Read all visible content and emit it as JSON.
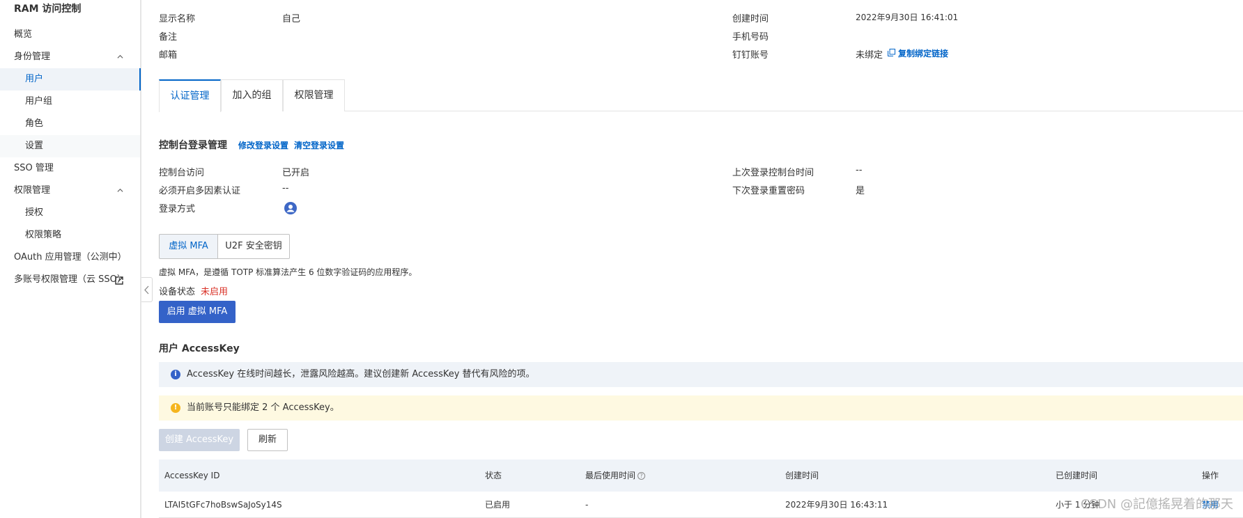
{
  "sidebar": {
    "title": "RAM 访问控制",
    "items": [
      {
        "label": "概览"
      },
      {
        "label": "身份管理"
      },
      {
        "label": "用户"
      },
      {
        "label": "用户组"
      },
      {
        "label": "角色"
      },
      {
        "label": "设置"
      },
      {
        "label": "SSO 管理"
      },
      {
        "label": "权限管理"
      },
      {
        "label": "授权"
      },
      {
        "label": "权限策略"
      },
      {
        "label": "OAuth 应用管理（公测中）"
      },
      {
        "label": "多账号权限管理（云 SSO）"
      }
    ]
  },
  "basic_info": {
    "display_name_label": "显示名称",
    "display_name_value": "自己",
    "remark_label": "备注",
    "email_label": "邮箱",
    "created_label": "创建时间",
    "created_value": "2022年9月30日 16:41:01",
    "phone_label": "手机号码",
    "dingtalk_label": "钉钉账号",
    "dingtalk_value": "未绑定",
    "copy_bind_link": "复制绑定链接"
  },
  "tabs": [
    {
      "label": "认证管理"
    },
    {
      "label": "加入的组"
    },
    {
      "label": "权限管理"
    }
  ],
  "console_login": {
    "title": "控制台登录管理",
    "edit_link": "修改登录设置",
    "clear_link": "清空登录设置",
    "access_label": "控制台访问",
    "access_value": "已开启",
    "mfa_label": "必须开启多因素认证",
    "mfa_value": "--",
    "method_label": "登录方式",
    "last_login_label": "上次登录控制台时间",
    "last_login_value": "--",
    "reset_pwd_label": "下次登录重置密码",
    "reset_pwd_value": "是"
  },
  "mfa": {
    "tabs": [
      {
        "label": "虚拟 MFA"
      },
      {
        "label": "U2F 安全密钥"
      }
    ],
    "description": "虚拟 MFA，是遵循 TOTP 标准算法产生 6 位数字验证码的应用程序。",
    "status_label": "设备状态",
    "status_value": "未启用",
    "enable_button": "启用 虚拟 MFA"
  },
  "accesskey": {
    "title": "用户 AccessKey",
    "info_banner": "AccessKey 在线时间越长，泄露风险越高。建议创建新 AccessKey 替代有风险的项。",
    "warn_banner": "当前账号只能绑定 2 个 AccessKey。",
    "create_button": "创建 AccessKey",
    "refresh_button": "刷新",
    "columns": [
      "AccessKey ID",
      "状态",
      "最后使用时间",
      "创建时间",
      "已创建时间",
      "操作"
    ],
    "rows": [
      {
        "id": "LTAI5tGFc7hoBswSaJoSy14S",
        "status": "已启用",
        "last_used": "-",
        "created": "2022年9月30日 16:43:11",
        "age": "小于 1 分钟",
        "action": "禁用"
      }
    ]
  },
  "watermark": "CSDN @記億搖晃着的那天",
  "colors": {
    "accent": "#0064c8",
    "primary_button": "#3462c8",
    "danger": "#d93026",
    "info_bg": "#eff3f8",
    "warn_bg": "#fef9e1"
  }
}
